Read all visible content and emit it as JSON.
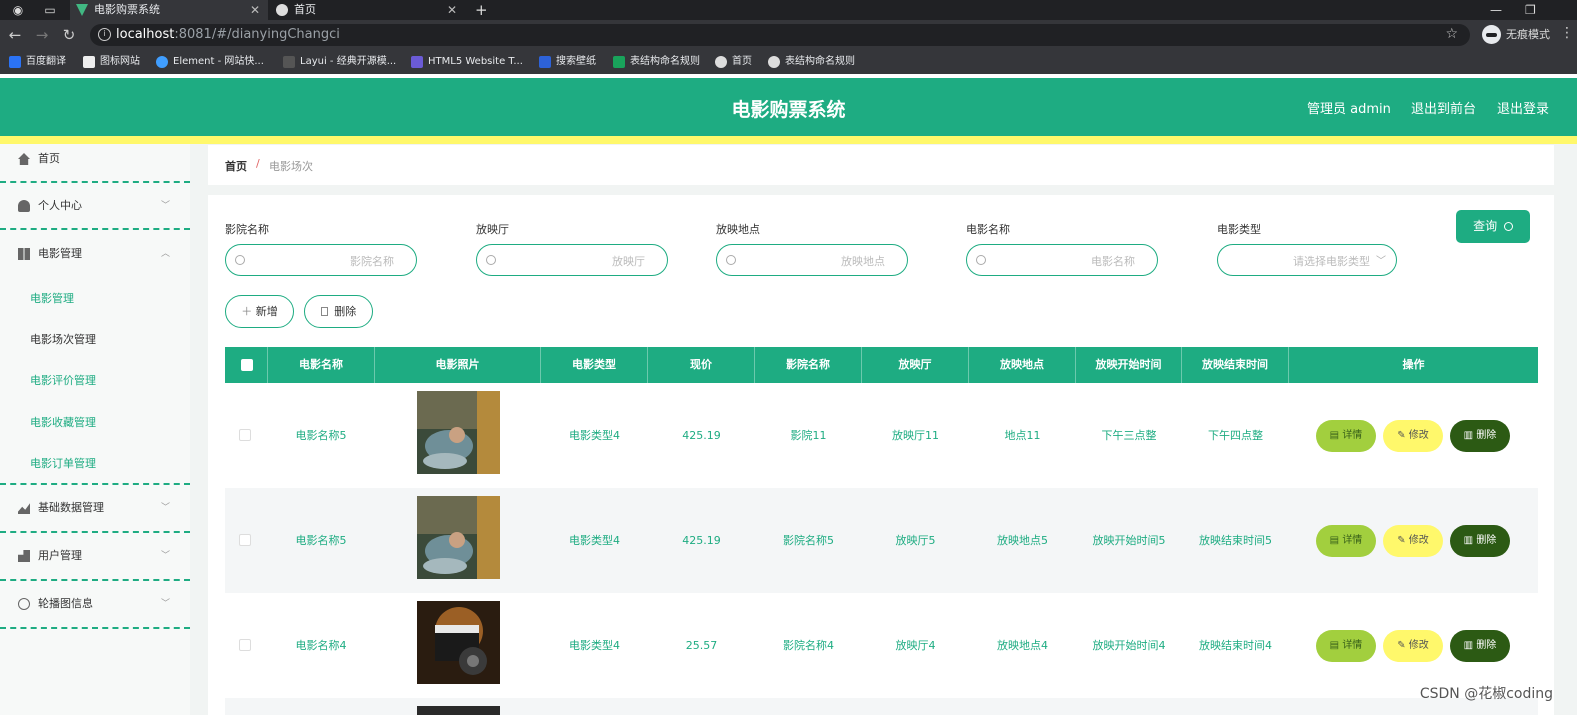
{
  "browser": {
    "tabs": [
      {
        "title": "电影购票系统",
        "active": true
      },
      {
        "title": "首页",
        "active": false
      }
    ],
    "url_host": "localhost",
    "url_rest": ":8081/#/dianyingChangci",
    "incognito_label": "无痕模式",
    "bookmarks": [
      "百度翻译",
      "图标网站",
      "Element - 网站快...",
      "Layui - 经典开源模...",
      "HTML5 Website T...",
      "搜索壁纸",
      "表结构命名规则",
      "首页",
      "表结构命名规则"
    ]
  },
  "header": {
    "title": "电影购票系统",
    "user": "管理员 admin",
    "front_link": "退出到前台",
    "logout": "退出登录"
  },
  "sidebar": {
    "home": "首页",
    "personal": "个人中心",
    "movie_mgmt": "电影管理",
    "sub_items": [
      "电影管理",
      "电影场次管理",
      "电影评价管理",
      "电影收藏管理",
      "电影订单管理"
    ],
    "basic_data": "基础数据管理",
    "user_mgmt": "用户管理",
    "carousel": "轮播图信息"
  },
  "breadcrumb": {
    "home": "首页",
    "sep": "/",
    "current": "电影场次"
  },
  "filters": {
    "cinema_label": "影院名称",
    "cinema_placeholder": "影院名称",
    "hall_label": "放映厅",
    "hall_placeholder": "放映厅",
    "location_label": "放映地点",
    "location_placeholder": "放映地点",
    "movie_label": "电影名称",
    "movie_placeholder": "电影名称",
    "type_label": "电影类型",
    "type_placeholder": "请选择电影类型",
    "query_label": "查询",
    "add_label": "新增",
    "delete_label": "删除"
  },
  "table": {
    "headers": [
      "电影名称",
      "电影照片",
      "电影类型",
      "现价",
      "影院名称",
      "放映厅",
      "放映地点",
      "放映开始时间",
      "放映结束时间",
      "操作"
    ],
    "rows": [
      {
        "name": "电影名称5",
        "type": "电影类型4",
        "price": "425.19",
        "cinema": "影院11",
        "hall": "放映厅11",
        "location": "地点11",
        "start": "下午三点整",
        "end": "下午四点整"
      },
      {
        "name": "电影名称5",
        "type": "电影类型4",
        "price": "425.19",
        "cinema": "影院名称5",
        "hall": "放映厅5",
        "location": "放映地点5",
        "start": "放映开始时间5",
        "end": "放映结束时间5"
      },
      {
        "name": "电影名称4",
        "type": "电影类型4",
        "price": "25.57",
        "cinema": "影院名称4",
        "hall": "放映厅4",
        "location": "放映地点4",
        "start": "放映开始时间4",
        "end": "放映结束时间4"
      }
    ],
    "detail_label": "详情",
    "edit_label": "修改",
    "delete_label": "删除"
  },
  "watermark": "CSDN @花椒coding",
  "colors": {
    "primary": "#1eac82",
    "accent_yellow": "#fff86b",
    "detail_btn": "#a2cf3e",
    "delete_btn": "#2c5a14"
  }
}
